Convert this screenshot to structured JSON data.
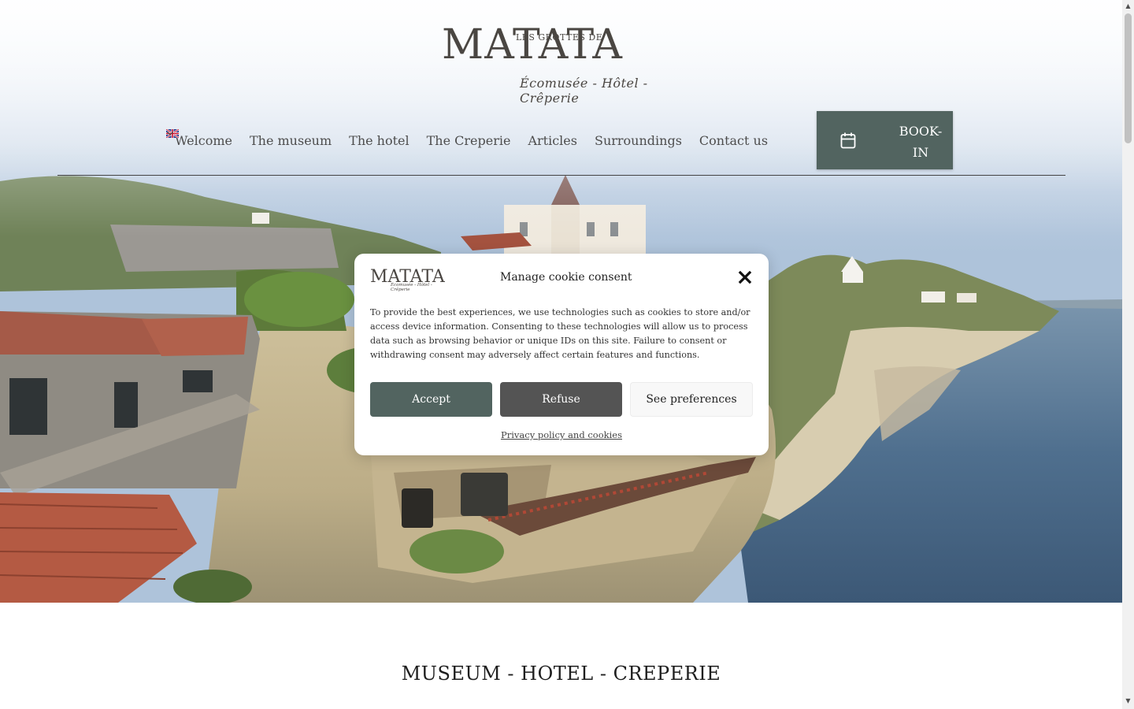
{
  "brand": {
    "caption": "Les Grottes de",
    "name": "MATATA",
    "tagline": "Écomusée - Hôtel - Crêperie"
  },
  "nav": {
    "items": [
      "Welcome",
      "The museum",
      "The hotel",
      "The Creperie",
      "Articles",
      "Surroundings",
      "Contact us"
    ],
    "language_icon": "uk-flag-icon",
    "chevron_icon": "chevron-down-icon"
  },
  "booking": {
    "label": "BOOK-IN",
    "icon": "calendar-icon"
  },
  "cookie": {
    "title": "Manage cookie consent",
    "body": "To provide the best experiences, we use technologies such as cookies to store and/or access device information. Consenting to these technologies will allow us to process data such as browsing behavior or unique IDs on this site. Failure to consent or withdrawing consent may adversely affect certain features and functions.",
    "accept": "Accept",
    "refuse": "Refuse",
    "preferences": "See preferences",
    "privacy_link": "Privacy policy and cookies",
    "close_icon": "close-icon"
  },
  "main": {
    "heading": "MUSEUM - HOTEL - CREPERIE"
  },
  "colors": {
    "accent": "#526460",
    "refuse": "#545454",
    "text": "#3e3e3e"
  }
}
